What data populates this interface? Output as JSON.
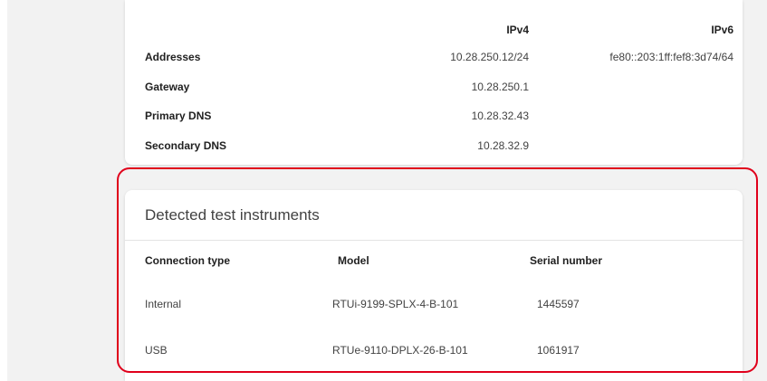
{
  "network": {
    "col_ipv4": "IPv4",
    "col_ipv6": "IPv6",
    "rows": [
      {
        "label": "Addresses",
        "ipv4": "10.28.250.12/24",
        "ipv6": "fe80::203:1ff:fef8:3d74/64"
      },
      {
        "label": "Gateway",
        "ipv4": "10.28.250.1",
        "ipv6": ""
      },
      {
        "label": "Primary DNS",
        "ipv4": "10.28.32.43",
        "ipv6": ""
      },
      {
        "label": "Secondary DNS",
        "ipv4": "10.28.32.9",
        "ipv6": ""
      }
    ]
  },
  "instruments": {
    "title": "Detected test instruments",
    "headers": {
      "connection": "Connection type",
      "model": "Model",
      "serial": "Serial number"
    },
    "rows": [
      {
        "connection": "Internal",
        "model": "RTUi-9199-SPLX-4-B-101",
        "serial": "1445597"
      },
      {
        "connection": "USB",
        "model": "RTUe-9110-DPLX-26-B-101",
        "serial": "1061917"
      }
    ]
  },
  "colors": {
    "highlight": "#e0001b",
    "background": "#f2f2f2",
    "card": "#ffffff"
  }
}
